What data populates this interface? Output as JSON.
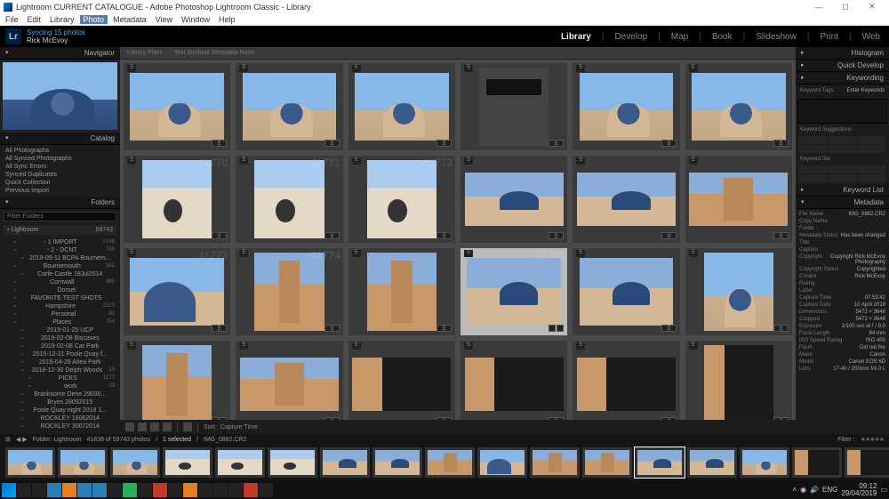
{
  "titlebar": {
    "title": "Lightroom CURRENT CATALOGUE - Adobe Photoshop Lightroom Classic - Library"
  },
  "menu": {
    "items": [
      "File",
      "Edit",
      "Library",
      "Photo",
      "Metadata",
      "View",
      "Window",
      "Help"
    ],
    "active": "Photo"
  },
  "identity": {
    "logo": "Lr",
    "syncing": "Syncing 15 photos",
    "name": "Rick McEvoy"
  },
  "modules": {
    "items": [
      "Library",
      "Develop",
      "Map",
      "Book",
      "Slideshow",
      "Print",
      "Web"
    ],
    "active": "Library"
  },
  "left": {
    "navigator": "Navigator",
    "catalog_hdr": "Catalog",
    "catalog": [
      {
        "name": "All Photographs",
        "count": ""
      },
      {
        "name": "All Synced Photographs",
        "count": ""
      },
      {
        "name": "All Sync Errors",
        "count": ""
      },
      {
        "name": "Synced Duplicates",
        "count": ""
      },
      {
        "name": "Quick Collection",
        "count": ""
      },
      {
        "name": "Previous Import",
        "count": ""
      }
    ],
    "folders_hdr": "Folders",
    "filter_placeholder": "Filter Folders",
    "volume": {
      "name": "Lightroom",
      "count": "59743"
    },
    "folders": [
      {
        "name": "- 1 IMPORT",
        "count": "2198",
        "indent": 1
      },
      {
        "name": "- 2 - DCNT",
        "count": "705",
        "indent": 1
      },
      {
        "name": "2019-05-11 BCPA Bournem...",
        "count": "",
        "indent": 2
      },
      {
        "name": "Bournemouth",
        "count": "582",
        "indent": 1
      },
      {
        "name": "Corfe Castle 18Jul2014",
        "count": "",
        "indent": 2
      },
      {
        "name": "Cornwall",
        "count": "960",
        "indent": 1
      },
      {
        "name": "Dorset",
        "count": "",
        "indent": 1
      },
      {
        "name": "FAVORITE TEST SHOTS",
        "count": "",
        "indent": 1
      },
      {
        "name": "Hampshire",
        "count": "2523",
        "indent": 1
      },
      {
        "name": "Personal",
        "count": "92",
        "indent": 1
      },
      {
        "name": "Places",
        "count": "754",
        "indent": 1
      },
      {
        "name": "2019-01-25 UCP",
        "count": "",
        "indent": 2
      },
      {
        "name": "2019-02-08 Biscases",
        "count": "",
        "indent": 2
      },
      {
        "name": "2019-02-08 Car Park",
        "count": "",
        "indent": 2
      },
      {
        "name": "2015-12-21 Poole Quay f...",
        "count": "",
        "indent": 2
      },
      {
        "name": "2019-04-26 Altea Park",
        "count": "",
        "indent": 2
      },
      {
        "name": "2018-12-30 Delph Woods",
        "count": "19",
        "indent": 2
      },
      {
        "name": "PICKS",
        "count": "1177",
        "indent": 3
      },
      {
        "name": "work",
        "count": "19",
        "indent": 3
      },
      {
        "name": "Branksome Dene 29030...",
        "count": "",
        "indent": 2
      },
      {
        "name": "Bryes 28092015",
        "count": "",
        "indent": 2
      },
      {
        "name": "Poole Quay night 2018 1...",
        "count": "",
        "indent": 2
      },
      {
        "name": "ROCKLEY 16062014",
        "count": "",
        "indent": 2
      },
      {
        "name": "ROCKLEY 30072014",
        "count": "",
        "indent": 2
      }
    ]
  },
  "filterbar": {
    "label": "Library Filter:",
    "items": [
      "Text",
      "Attribute",
      "Metadata",
      "None"
    ]
  },
  "grid": {
    "ghost_prefix": "41",
    "cells": [
      {
        "cls": "sky-dome",
        "shape": ""
      },
      {
        "cls": "sky-dome",
        "shape": ""
      },
      {
        "cls": "sky-dome",
        "shape": ""
      },
      {
        "cls": "plaza",
        "shape": "tall"
      },
      {
        "cls": "sky-dome",
        "shape": ""
      },
      {
        "cls": "sky-dome",
        "shape": ""
      },
      {
        "cls": "circ-win",
        "shape": "tall",
        "num": "770"
      },
      {
        "cls": "circ-win",
        "shape": "tall",
        "num": "771"
      },
      {
        "cls": "circ-win",
        "shape": "tall",
        "num": "772"
      },
      {
        "cls": "wide-dome",
        "shape": "wide"
      },
      {
        "cls": "wide-dome",
        "shape": "wide"
      },
      {
        "cls": "tower",
        "shape": "wide"
      },
      {
        "cls": "sky-dome2",
        "shape": "",
        "num": "773"
      },
      {
        "cls": "tower",
        "shape": "tall",
        "num": "774"
      },
      {
        "cls": "tower",
        "shape": "tall"
      },
      {
        "cls": "wide-dome",
        "shape": "",
        "selected": true,
        "num": "776"
      },
      {
        "cls": "wide-dome",
        "shape": ""
      },
      {
        "cls": "sky-dome",
        "shape": "tall"
      },
      {
        "cls": "tower",
        "shape": "tall"
      },
      {
        "cls": "tower",
        "shape": "wide"
      },
      {
        "cls": "dark-alley",
        "shape": "wide"
      },
      {
        "cls": "dark-alley",
        "shape": "wide"
      },
      {
        "cls": "dark-alley",
        "shape": "wide"
      },
      {
        "cls": "dark-alley",
        "shape": "tall"
      }
    ]
  },
  "toolbar": {
    "sort_label": "Sort:",
    "sort_value": "Capture Time"
  },
  "right": {
    "histogram": "Histogram",
    "quick_dev": "Quick Develop",
    "keywording": "Keywording",
    "keyword_tags": "Keyword Tags",
    "enter_kw": "Enter Keywords",
    "kw_sugg": "Keyword Suggestions",
    "kw_set": "Keyword Set",
    "keyword_list": "Keyword List",
    "metadata_hdr": "Metadata",
    "metadata": [
      {
        "lbl": "File Name",
        "val": "IMG_0862.CR2"
      },
      {
        "lbl": "Copy Name",
        "val": ""
      },
      {
        "lbl": "Folder",
        "val": ""
      },
      {
        "lbl": "Metadata Status",
        "val": "Has been changed"
      },
      {
        "lbl": "Title",
        "val": ""
      },
      {
        "lbl": "Caption",
        "val": ""
      },
      {
        "lbl": "Copyright",
        "val": "Copyright Rick McEvoy Photography"
      },
      {
        "lbl": "Copyright Status",
        "val": "Copyrighted"
      },
      {
        "lbl": "Creator",
        "val": "Rick McEvoy"
      },
      {
        "lbl": "Rating",
        "val": ""
      },
      {
        "lbl": "Label",
        "val": ""
      },
      {
        "lbl": "Capture Time",
        "val": "07:53:42"
      },
      {
        "lbl": "Capture Date",
        "val": "10 April 2019"
      },
      {
        "lbl": "Dimensions",
        "val": "5472 × 3648"
      },
      {
        "lbl": "Cropped",
        "val": "5472 × 3648"
      },
      {
        "lbl": "Exposure",
        "val": "1/100 sec at f / 8.0"
      },
      {
        "lbl": "Focal Length",
        "val": "84 mm"
      },
      {
        "lbl": "ISO Speed Rating",
        "val": "ISO 400"
      },
      {
        "lbl": "Flash",
        "val": "Did not fire"
      },
      {
        "lbl": "Make",
        "val": "Canon"
      },
      {
        "lbl": "Model",
        "val": "Canon EOS 6D"
      },
      {
        "lbl": "Lens",
        "val": "17-40 / 200mm f/4.0 L"
      }
    ]
  },
  "filmstrip": {
    "nav_square": "⊞",
    "nav_arrows": "◀ ▶",
    "path_label": "Folder: Lightroom",
    "count": "41838 of 59743 photos",
    "selected": "1 selected",
    "filename": "IMG_0862.CR2",
    "filter_label": "Filter :",
    "thumbs": [
      "sky-dome",
      "sky-dome",
      "sky-dome",
      "circ-win",
      "circ-win",
      "circ-win",
      "wide-dome",
      "wide-dome",
      "tower",
      "sky-dome2",
      "tower",
      "tower",
      "wide-dome",
      "wide-dome",
      "sky-dome",
      "dark-alley",
      "dark-alley",
      "dark-alley"
    ],
    "selected_idx": 12
  },
  "taskbar": {
    "lang": "ENG",
    "time": "09:12",
    "date": "29/04/2019"
  }
}
